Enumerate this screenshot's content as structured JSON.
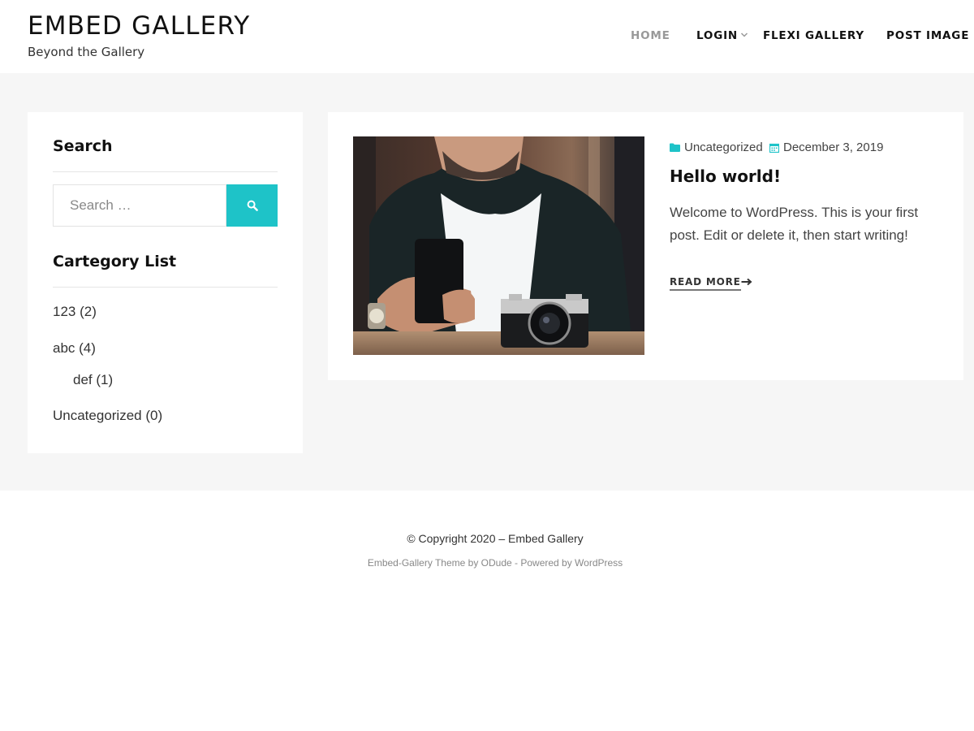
{
  "header": {
    "site_title": "EMBED GALLERY",
    "tagline": "Beyond the Gallery",
    "nav": {
      "home": "HOME",
      "login": "LOGIN",
      "flexi_gallery": "FLEXI GALLERY",
      "post_image": "POST IMAGE"
    }
  },
  "sidebar": {
    "search": {
      "title": "Search",
      "placeholder": "Search …"
    },
    "categories": {
      "title": "Cartegory List",
      "items": [
        {
          "label": "123 (2)"
        },
        {
          "label": "abc (4)"
        },
        {
          "label": "def (1)"
        },
        {
          "label": "Uncategorized (0)"
        }
      ]
    }
  },
  "post": {
    "category": "Uncategorized",
    "date": "December 3, 2019",
    "title": "Hello world!",
    "excerpt": "Welcome to WordPress. This is your first post. Edit or delete it, then start writing!",
    "read_more": "READ MORE"
  },
  "footer": {
    "copyright": "© Copyright 2020 – Embed Gallery",
    "theme_link": "Embed-Gallery Theme by ODude",
    "separator": " - ",
    "powered_link": "Powered by WordPress"
  },
  "colors": {
    "accent": "#1ec3c8",
    "band_background": "#f6f6f6",
    "nav_active": "#999999"
  },
  "icons": {
    "search_button": "search-icon",
    "nav_login": "chevron-down-icon",
    "meta_category": "folder-icon",
    "meta_date": "calendar-icon",
    "read_more": "arrow-right-icon"
  }
}
